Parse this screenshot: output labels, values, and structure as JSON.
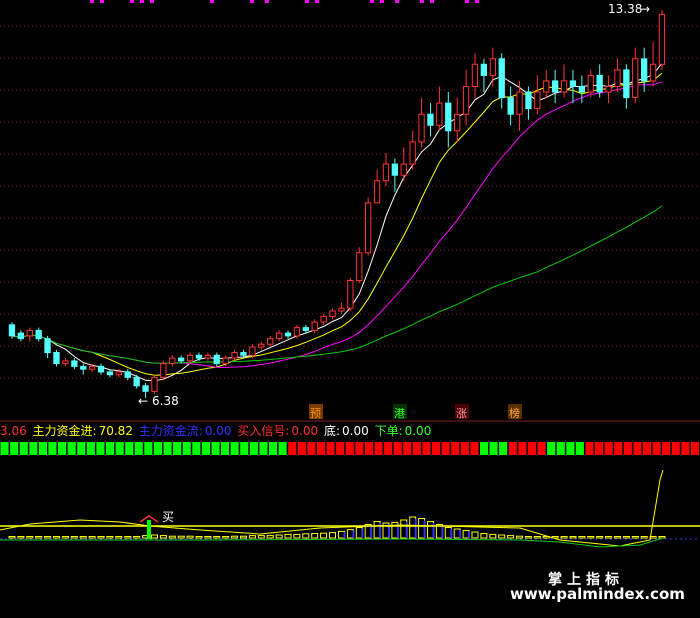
{
  "colors": {
    "background": "#000000",
    "up": "#ff3333",
    "down": "#54ffff",
    "ma5": "#ffffff",
    "ma10": "#ffff00",
    "ma20": "#ff00ff",
    "ma60": "#00cc00",
    "grid": "#7f1f1f"
  },
  "price_chart": {
    "high_label": "13.38",
    "low_label": "6.38",
    "markers": [
      "预",
      "港",
      "涨",
      "榜"
    ]
  },
  "indicator_legend": {
    "first_value": "3.06",
    "items": [
      {
        "label": "主力资金进:",
        "value": "70.82",
        "color": "#ffff00"
      },
      {
        "label": "主力资金流:",
        "value": "0.00",
        "color": "#3333ff"
      },
      {
        "label": "买入信号:",
        "value": "0.00",
        "color": "#ff3333"
      },
      {
        "label": "底:",
        "value": "0.00",
        "color": "#ffffff"
      },
      {
        "label": "下单:",
        "value": "0.00",
        "color": "#33ff33"
      }
    ]
  },
  "buy_label": "买",
  "watermark": {
    "brand": "掌上指标",
    "url": "www.palmindex.com"
  },
  "chart_data": {
    "type": "candlestick",
    "price_range": [
      6.38,
      13.38
    ],
    "signal_squares": "GGGGGGGGGGGGGGGGGGGGGGGGGGGGGGRRRRRRRRRRRRRRRRRRRRGGGRRRRGGGGRRRRRRRRRRRR",
    "candles": [
      [
        7.7,
        7.5,
        7.75,
        7.45
      ],
      [
        7.55,
        7.45,
        7.6,
        7.4
      ],
      [
        7.5,
        7.6,
        7.65,
        7.4
      ],
      [
        7.6,
        7.45,
        7.65,
        7.4
      ],
      [
        7.45,
        7.2,
        7.5,
        7.1
      ],
      [
        7.2,
        7.0,
        7.25,
        6.95
      ],
      [
        7.0,
        7.05,
        7.1,
        6.95
      ],
      [
        7.05,
        6.95,
        7.1,
        6.9
      ],
      [
        6.95,
        6.9,
        7.0,
        6.8
      ],
      [
        6.9,
        6.95,
        7.0,
        6.85
      ],
      [
        6.95,
        6.85,
        7.0,
        6.8
      ],
      [
        6.85,
        6.8,
        6.9,
        6.75
      ],
      [
        6.8,
        6.85,
        6.9,
        6.75
      ],
      [
        6.85,
        6.75,
        6.9,
        6.7
      ],
      [
        6.75,
        6.6,
        6.8,
        6.55
      ],
      [
        6.6,
        6.5,
        6.65,
        6.38
      ],
      [
        6.5,
        6.75,
        6.8,
        6.45
      ],
      [
        6.75,
        7.0,
        7.05,
        6.7
      ],
      [
        7.0,
        7.1,
        7.15,
        6.95
      ],
      [
        7.1,
        7.05,
        7.15,
        7.0
      ],
      [
        7.05,
        7.15,
        7.2,
        7.0
      ],
      [
        7.15,
        7.1,
        7.2,
        7.05
      ],
      [
        7.1,
        7.15,
        7.2,
        7.05
      ],
      [
        7.15,
        7.0,
        7.2,
        6.95
      ],
      [
        7.0,
        7.1,
        7.15,
        6.95
      ],
      [
        7.1,
        7.2,
        7.25,
        7.05
      ],
      [
        7.2,
        7.15,
        7.25,
        7.1
      ],
      [
        7.15,
        7.3,
        7.35,
        7.1
      ],
      [
        7.3,
        7.35,
        7.4,
        7.25
      ],
      [
        7.35,
        7.45,
        7.5,
        7.3
      ],
      [
        7.45,
        7.55,
        7.6,
        7.4
      ],
      [
        7.55,
        7.5,
        7.6,
        7.45
      ],
      [
        7.5,
        7.65,
        7.7,
        7.45
      ],
      [
        7.65,
        7.6,
        7.7,
        7.55
      ],
      [
        7.6,
        7.75,
        7.8,
        7.55
      ],
      [
        7.75,
        7.85,
        7.9,
        7.7
      ],
      [
        7.85,
        7.95,
        8.0,
        7.8
      ],
      [
        7.95,
        8.0,
        8.1,
        7.9
      ],
      [
        8.0,
        8.5,
        8.55,
        7.95
      ],
      [
        8.5,
        9.0,
        9.1,
        8.45
      ],
      [
        9.0,
        9.9,
        10.0,
        8.95
      ],
      [
        9.9,
        10.3,
        10.5,
        9.9
      ],
      [
        10.3,
        10.6,
        10.8,
        10.2
      ],
      [
        10.6,
        10.4,
        10.7,
        10.1
      ],
      [
        10.4,
        10.6,
        10.9,
        10.3
      ],
      [
        10.6,
        11.0,
        11.2,
        10.5
      ],
      [
        11.0,
        11.5,
        11.8,
        10.9
      ],
      [
        11.5,
        11.3,
        11.7,
        11.1
      ],
      [
        11.3,
        11.7,
        12.0,
        11.2
      ],
      [
        11.7,
        11.2,
        11.9,
        10.9
      ],
      [
        11.2,
        11.5,
        11.8,
        11.0
      ],
      [
        11.5,
        12.0,
        12.3,
        11.3
      ],
      [
        12.0,
        12.4,
        12.6,
        11.8
      ],
      [
        12.4,
        12.2,
        12.5,
        11.9
      ],
      [
        12.2,
        12.5,
        12.7,
        12.0
      ],
      [
        12.5,
        11.8,
        12.6,
        11.6
      ],
      [
        11.8,
        11.5,
        12.0,
        11.3
      ],
      [
        11.5,
        11.9,
        12.1,
        11.2
      ],
      [
        11.9,
        11.6,
        12.0,
        11.4
      ],
      [
        11.6,
        11.9,
        12.2,
        11.5
      ],
      [
        11.9,
        12.1,
        12.3,
        11.8
      ],
      [
        12.1,
        11.9,
        12.3,
        11.7
      ],
      [
        11.9,
        12.1,
        12.4,
        11.8
      ],
      [
        12.1,
        12.0,
        12.3,
        11.7
      ],
      [
        12.0,
        11.9,
        12.2,
        11.7
      ],
      [
        11.9,
        12.2,
        12.3,
        11.8
      ],
      [
        12.2,
        11.9,
        12.4,
        11.8
      ],
      [
        11.9,
        12.0,
        12.2,
        11.7
      ],
      [
        12.0,
        12.3,
        12.5,
        11.9
      ],
      [
        12.3,
        11.8,
        12.4,
        11.6
      ],
      [
        11.8,
        12.5,
        12.7,
        11.7
      ],
      [
        12.5,
        12.1,
        12.7,
        11.9
      ],
      [
        12.1,
        12.4,
        12.8,
        12.0
      ],
      [
        12.4,
        13.3,
        13.38,
        12.3
      ]
    ],
    "volume_bars": [
      0.05,
      0.05,
      0.05,
      0.05,
      0.05,
      0.05,
      0.05,
      0.05,
      0.05,
      0.05,
      0.05,
      0.05,
      0.05,
      0.05,
      0.05,
      0.08,
      0.1,
      0.08,
      0.06,
      0.06,
      0.06,
      0.05,
      0.05,
      0.05,
      0.05,
      0.06,
      0.06,
      0.08,
      0.08,
      0.08,
      0.1,
      0.12,
      0.12,
      0.14,
      0.15,
      0.16,
      0.18,
      0.22,
      0.28,
      0.35,
      0.45,
      0.55,
      0.5,
      0.52,
      0.6,
      0.7,
      0.65,
      0.55,
      0.45,
      0.35,
      0.3,
      0.25,
      0.2,
      0.15,
      0.12,
      0.1,
      0.08,
      0.06,
      0.05,
      0.05,
      0.05,
      0.05,
      0.05,
      0.05,
      0.05,
      0.05,
      0.05,
      0.05,
      0.05,
      0.05,
      0.05,
      0.05,
      0.05,
      0.05
    ]
  }
}
